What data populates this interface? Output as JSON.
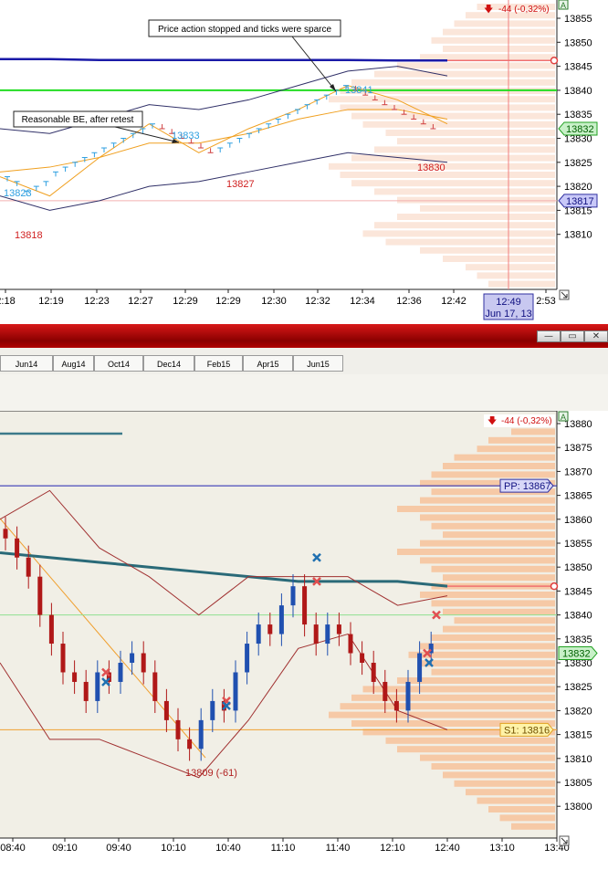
{
  "chart_data": [
    {
      "type": "line",
      "y_ticks": [
        "13855",
        "13850",
        "13845",
        "13840",
        "13835",
        "13830",
        "13825",
        "13820",
        "13815",
        "13810"
      ],
      "x_ticks": [
        "2:18",
        "12:19",
        "12:23",
        "12:27",
        "12:29",
        "12:29",
        "12:30",
        "12:32",
        "12:34",
        "12:36",
        "12:42",
        "2:53"
      ],
      "ylim": [
        13807,
        13857
      ],
      "pnl_badge": "-44 (-0,32%)",
      "price_tags": [
        "13832",
        "13817"
      ],
      "cursor_time_line1": "12:49",
      "cursor_time_line2": "Jun 17, 13",
      "annotations": [
        "Price action stopped and ticks were sparce",
        "Reasonable BE, after retest"
      ],
      "labels": [
        {
          "text": "13823",
          "color": "#2e9fe0"
        },
        {
          "text": "13818",
          "color": "#d02020"
        },
        {
          "text": "13833",
          "color": "#2e9fe0"
        },
        {
          "text": "13827",
          "color": "#d02020"
        },
        {
          "text": "13841",
          "color": "#2e9fe0"
        },
        {
          "text": "13830",
          "color": "#d02020"
        }
      ],
      "series": [
        {
          "values": [
            13846.5,
            13846.5,
            13846.3,
            13846.3,
            13846.3,
            13846.3,
            13846.3,
            13846.3,
            13846.2,
            13846.2
          ],
          "color": "#1a1aa8"
        },
        {
          "values": [
            13840,
            13840,
            13840,
            13840,
            13840,
            13840,
            13840,
            13840,
            13840,
            13840
          ],
          "color": "#22dd22"
        },
        {
          "values": [
            13832,
            13831,
            13834,
            13837,
            13836,
            13838,
            13841,
            13844,
            13845,
            13843
          ],
          "color": "#303068"
        },
        {
          "values": [
            13818,
            13815,
            13817,
            13820,
            13821,
            13823,
            13825,
            13827,
            13826,
            13825
          ],
          "color": "#303068"
        },
        {
          "values": [
            13823,
            13824,
            13826,
            13829,
            13829,
            13831,
            13834,
            13836,
            13836,
            13834
          ],
          "color": "#f0a020"
        },
        {
          "values": [
            13822,
            13818,
            13826,
            13833,
            13827,
            13832,
            13836,
            13841,
            13838,
            13833
          ],
          "color": "#f0a020"
        }
      ]
    },
    {
      "type": "line",
      "y_ticks": [
        "13880",
        "13875",
        "13870",
        "13865",
        "13860",
        "13855",
        "13850",
        "13845",
        "13840",
        "13835",
        "13830",
        "13825",
        "13820",
        "13815",
        "13810",
        "13805",
        "13800"
      ],
      "x_ticks": [
        "08:40",
        "09:10",
        "09:40",
        "10:10",
        "10:40",
        "11:10",
        "11:40",
        "12:10",
        "12:40",
        "13:10",
        "13:40"
      ],
      "ylim": [
        13797,
        13883
      ],
      "pnl_badge": "-44 (-0,32%)",
      "price_tags": [
        "PP: 13867",
        "13832",
        "S1: 13816"
      ],
      "labels": [
        {
          "text": "13809 (-61)",
          "color": "#b02020"
        }
      ],
      "series": [
        {
          "values": [
            13853,
            13852,
            13851,
            13850,
            13849,
            13848,
            13847,
            13847,
            13847,
            13846
          ],
          "color": "#2a6a78"
        },
        {
          "values": [
            13867,
            13867,
            13867,
            13867,
            13867,
            13867,
            13867,
            13867,
            13867,
            13867
          ],
          "color": "#2020b0"
        },
        {
          "values": [
            13840,
            13840,
            13840,
            13840,
            13840,
            13840,
            13840,
            13840,
            13840,
            13840
          ],
          "color": "#90e090"
        },
        {
          "values": [
            13816,
            13816,
            13816,
            13816,
            13816,
            13816,
            13816,
            13816,
            13816,
            13816
          ],
          "color": "#f0a030"
        },
        {
          "values": [
            13860,
            13866,
            13854,
            13848,
            13840,
            13848,
            13848,
            13848,
            13842,
            13844
          ],
          "color": "#a03030"
        },
        {
          "values": [
            13830,
            13814,
            13814,
            13810,
            13806,
            13818,
            13833,
            13836,
            13820,
            13816
          ],
          "color": "#a03030"
        }
      ]
    }
  ],
  "tabs": [
    "Jun14",
    "Aug14",
    "Oct14",
    "Dec14",
    "Feb15",
    "Apr15",
    "Jun15"
  ],
  "window_buttons": [
    "—",
    "▭",
    "✕"
  ],
  "a_badge": "A"
}
